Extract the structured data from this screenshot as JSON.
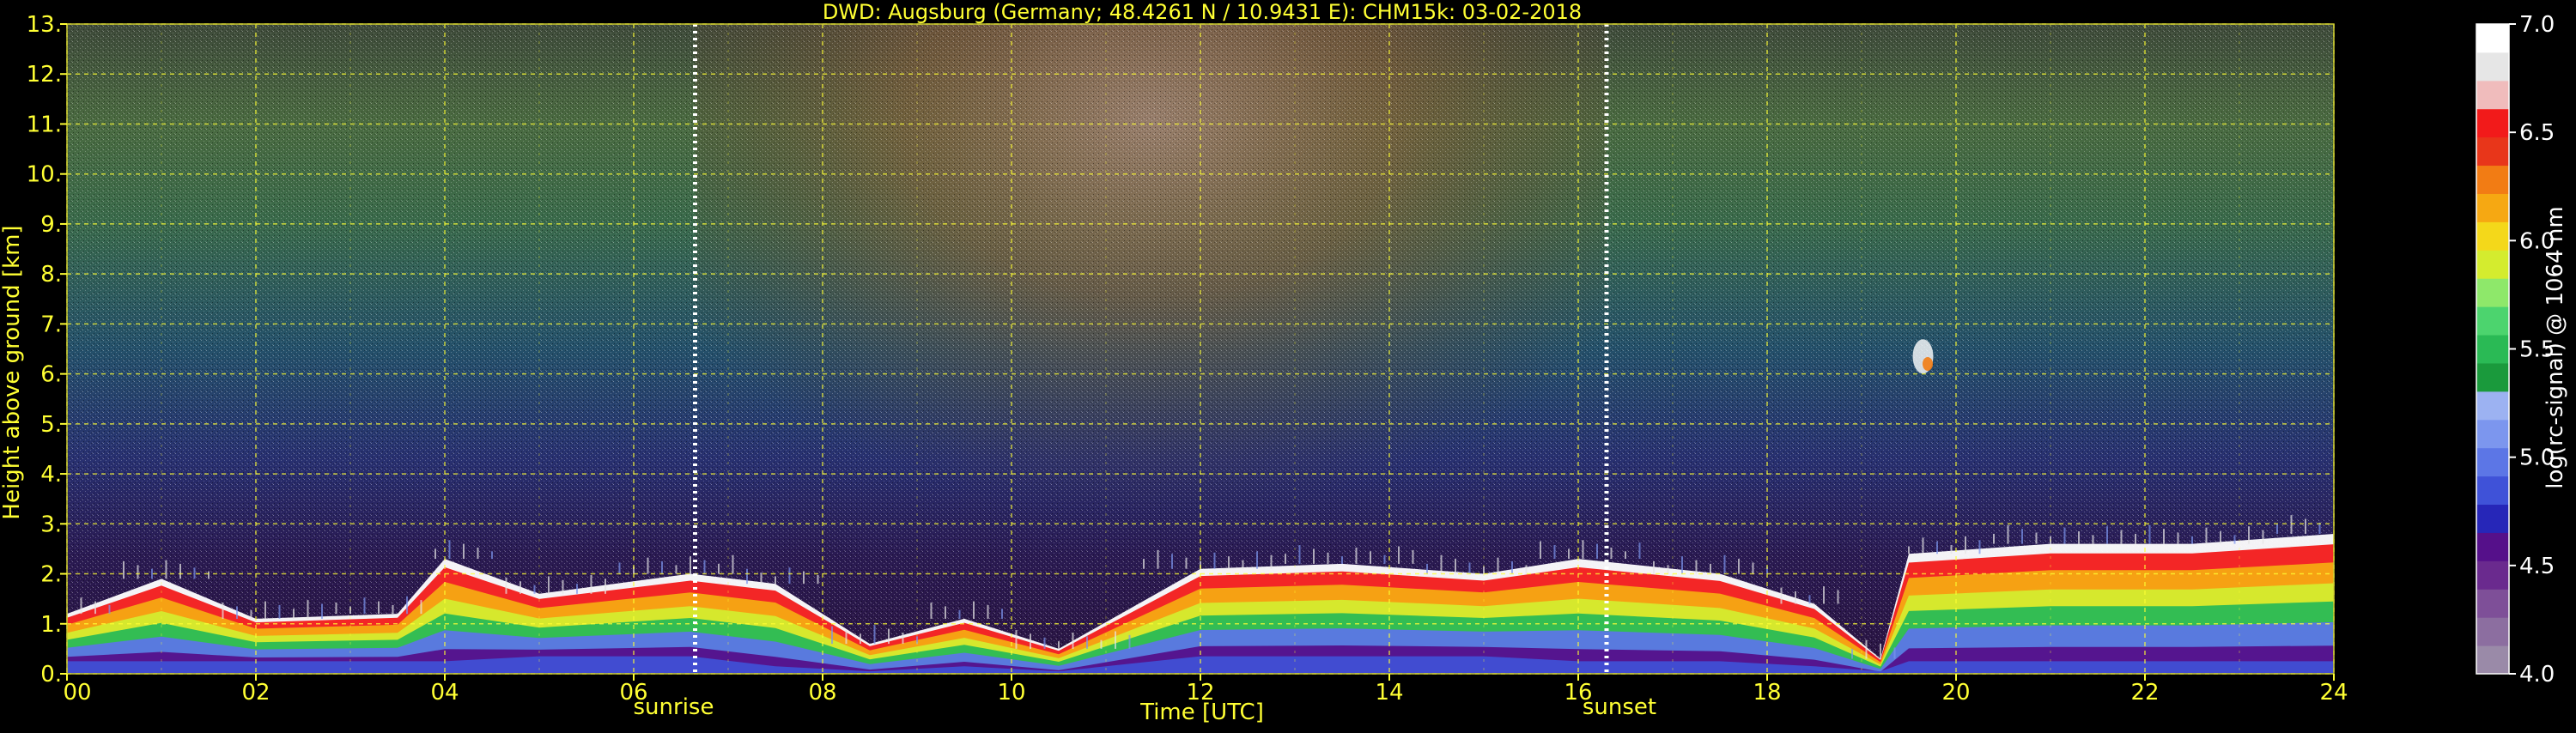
{
  "chart_data": {
    "type": "heatmap",
    "title": "DWD: Augsburg (Germany; 48.4261 N / 10.9431 E):    CHM15k: 03-02-2018",
    "xlabel": "Time [UTC]",
    "ylabel": "Height above ground [km]",
    "xlim": [
      0,
      24
    ],
    "ylim": [
      0,
      13
    ],
    "x_ticks": [
      0,
      2,
      4,
      6,
      8,
      10,
      12,
      14,
      16,
      18,
      20,
      22,
      24
    ],
    "x_tick_labels": [
      "00",
      "02",
      "04",
      "06",
      "08",
      "10",
      "12",
      "14",
      "16",
      "18",
      "20",
      "22",
      "24"
    ],
    "y_ticks": [
      0,
      1,
      2,
      3,
      4,
      5,
      6,
      7,
      8,
      9,
      10,
      11,
      12,
      13
    ],
    "y_tick_labels": [
      "0.",
      "1.",
      "2.",
      "3.",
      "4.",
      "5.",
      "6.",
      "7.",
      "8.",
      "9.",
      "10.",
      "11.",
      "12.",
      "13."
    ],
    "grid": true,
    "events": [
      {
        "label": "sunrise",
        "time": 6.65
      },
      {
        "label": "sunset",
        "time": 16.3
      }
    ],
    "colorbar": {
      "label": "log(rc-signal) @ 1064 nm",
      "range": [
        4.0,
        7.0
      ],
      "ticks": [
        4.0,
        4.5,
        5.0,
        5.5,
        6.0,
        6.5,
        7.0
      ],
      "tick_labels": [
        "4.0",
        "4.5",
        "5.0",
        "5.5",
        "6.0",
        "6.5",
        "7.0"
      ],
      "colors": [
        "#9a8aa8",
        "#8c6ea0",
        "#7e4f98",
        "#6a2a8e",
        "#55108a",
        "#2626b8",
        "#3f52d8",
        "#5c76e6",
        "#7c96ee",
        "#9cb2f2",
        "#1a9a3c",
        "#2aba55",
        "#4cd46e",
        "#8ee86a",
        "#d4ec2e",
        "#f4d81a",
        "#f6a812",
        "#f27c14",
        "#e8361a",
        "#f21a1a",
        "#f0bcbc",
        "#e6e6e6",
        "#ffffff"
      ]
    },
    "cloud_base_top_km": [
      {
        "t": 0.0,
        "base": 0.2,
        "top": 1.2
      },
      {
        "t": 1.0,
        "base": 0.2,
        "top": 1.9
      },
      {
        "t": 2.0,
        "base": 0.2,
        "top": 1.1
      },
      {
        "t": 3.5,
        "base": 0.2,
        "top": 1.2
      },
      {
        "t": 4.0,
        "base": 0.2,
        "top": 2.3
      },
      {
        "t": 5.0,
        "base": 0.3,
        "top": 1.6
      },
      {
        "t": 6.6,
        "base": 0.3,
        "top": 2.0
      },
      {
        "t": 7.5,
        "base": 0.1,
        "top": 1.8
      },
      {
        "t": 8.5,
        "base": 0.0,
        "top": 0.6
      },
      {
        "t": 9.5,
        "base": 0.1,
        "top": 1.1
      },
      {
        "t": 10.5,
        "base": 0.0,
        "top": 0.5
      },
      {
        "t": 12.0,
        "base": 0.3,
        "top": 2.1
      },
      {
        "t": 13.5,
        "base": 0.3,
        "top": 2.2
      },
      {
        "t": 15.0,
        "base": 0.3,
        "top": 2.0
      },
      {
        "t": 16.0,
        "base": 0.2,
        "top": 2.3
      },
      {
        "t": 17.5,
        "base": 0.2,
        "top": 2.0
      },
      {
        "t": 18.5,
        "base": 0.1,
        "top": 1.4
      },
      {
        "t": 19.2,
        "base": 0.0,
        "top": 0.3
      },
      {
        "t": 19.5,
        "base": 0.2,
        "top": 2.4
      },
      {
        "t": 21.0,
        "base": 0.2,
        "top": 2.6
      },
      {
        "t": 22.5,
        "base": 0.2,
        "top": 2.6
      },
      {
        "t": 24.0,
        "base": 0.2,
        "top": 2.8
      }
    ]
  }
}
